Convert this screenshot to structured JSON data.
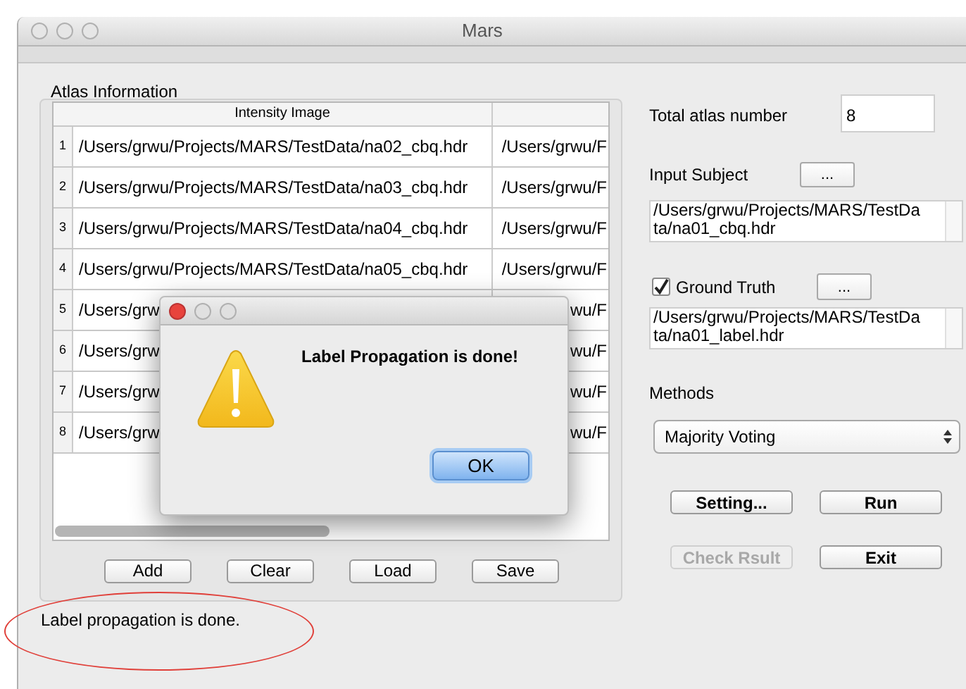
{
  "window": {
    "title": "Mars"
  },
  "atlas_panel": {
    "title": "Atlas Information",
    "table": {
      "columns": [
        "Intensity Image"
      ],
      "rows": [
        {
          "number": "1",
          "cells": [
            "/Users/grwu/Projects/MARS/TestData/na02_cbq.hdr",
            "/Users/grwu/F"
          ]
        },
        {
          "number": "2",
          "cells": [
            "/Users/grwu/Projects/MARS/TestData/na03_cbq.hdr",
            "/Users/grwu/F"
          ]
        },
        {
          "number": "3",
          "cells": [
            "/Users/grwu/Projects/MARS/TestData/na04_cbq.hdr",
            "/Users/grwu/F"
          ]
        },
        {
          "number": "4",
          "cells": [
            "/Users/grwu/Projects/MARS/TestData/na05_cbq.hdr",
            "/Users/grwu/F"
          ]
        },
        {
          "number": "5",
          "cells": [
            "/Users/grw",
            "wu/F"
          ]
        },
        {
          "number": "6",
          "cells": [
            "/Users/grw",
            "wu/F"
          ]
        },
        {
          "number": "7",
          "cells": [
            "/Users/grw",
            "wu/F"
          ]
        },
        {
          "number": "8",
          "cells": [
            "/Users/grw",
            "wu/F"
          ]
        }
      ]
    },
    "buttons": [
      "Add",
      "Clear",
      "Load",
      "Save"
    ]
  },
  "status": "Label propagation is done.",
  "right_panel": {
    "total_label": "Total atlas number",
    "total_value": "8",
    "input_subject": {
      "label": "Input Subject",
      "button": "...",
      "value": "/Users/grwu/Projects/MARS/TestData/na01_cbq.hdr"
    },
    "ground_truth": {
      "label": "Ground Truth",
      "checked": true,
      "button": "...",
      "value": "/Users/grwu/Projects/MARS/TestData/na01_label.hdr"
    },
    "methods": {
      "label": "Methods",
      "value": "Majority Voting"
    },
    "buttons": [
      {
        "label": "Setting...",
        "disabled": false
      },
      {
        "label": "Run",
        "disabled": false
      },
      {
        "label": "Check Rsult",
        "disabled": true
      },
      {
        "label": "Exit",
        "disabled": false
      }
    ]
  },
  "dialog": {
    "message": "Label Propagation is done!",
    "button": "OK"
  }
}
